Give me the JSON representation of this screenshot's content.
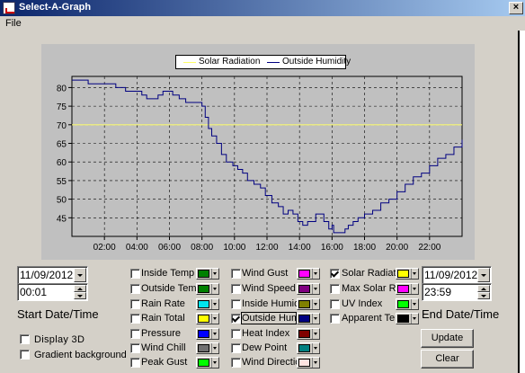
{
  "window": {
    "title": "Select-A-Graph",
    "close_label": "×"
  },
  "menu": {
    "file": "File"
  },
  "start": {
    "date": "11/09/2012",
    "time": "00:01",
    "label": "Start Date/Time"
  },
  "end": {
    "date": "11/09/2012",
    "time": "23:59",
    "label": "End Date/Time"
  },
  "display_options": [
    {
      "label": "Display 3D",
      "checked": false
    },
    {
      "label": "Gradient background",
      "checked": false
    }
  ],
  "series_options": [
    [
      {
        "label": "Inside Temp",
        "checked": false,
        "color": "#008000"
      },
      {
        "label": "Outside Temp",
        "checked": false,
        "color": "#008000"
      },
      {
        "label": "Rain Rate",
        "checked": false,
        "color": "#00e5ee"
      },
      {
        "label": "Rain Total",
        "checked": false,
        "color": "#ffff00"
      },
      {
        "label": "Pressure",
        "checked": false,
        "color": "#0000ff"
      },
      {
        "label": "Wind Chill",
        "checked": false,
        "color": "#707070"
      },
      {
        "label": "Peak Gust",
        "checked": false,
        "color": "#00ff00"
      }
    ],
    [
      {
        "label": "Wind Gust",
        "checked": false,
        "color": "#ff00ff"
      },
      {
        "label": "Wind Speed",
        "checked": false,
        "color": "#800080"
      },
      {
        "label": "Inside Humidity",
        "checked": false,
        "color": "#808000"
      },
      {
        "label": "Outside Humidit",
        "checked": true,
        "color": "#000080"
      },
      {
        "label": "Heat Index",
        "checked": false,
        "color": "#800000"
      },
      {
        "label": "Dew Point",
        "checked": false,
        "color": "#008080"
      },
      {
        "label": "Wind Direction",
        "checked": false,
        "color": "#ffe4e1"
      }
    ],
    [
      {
        "label": "Solar Radiation",
        "checked": true,
        "color": "#ffff00"
      },
      {
        "label": "Max Solar Rad",
        "checked": false,
        "color": "#ff00ff"
      },
      {
        "label": "UV Index",
        "checked": false,
        "color": "#00ff00"
      },
      {
        "label": "Apparent Temp",
        "checked": false,
        "color": "#000000"
      }
    ]
  ],
  "buttons": {
    "update": "Update",
    "clear": "Clear"
  },
  "chart_data": {
    "type": "line",
    "title": "",
    "xlabel": "",
    "ylabel": "",
    "xlim": [
      0,
      24
    ],
    "ylim": [
      40,
      83
    ],
    "x_ticks": [
      2,
      4,
      6,
      8,
      10,
      12,
      14,
      16,
      18,
      20,
      22
    ],
    "x_tick_labels": [
      "02:00",
      "04:00",
      "06:00",
      "08:00",
      "10:00",
      "12:00",
      "14:00",
      "16:00",
      "18:00",
      "20:00",
      "22:00"
    ],
    "y_ticks": [
      45,
      50,
      55,
      60,
      65,
      70,
      75,
      80
    ],
    "grid": true,
    "legend": "top-center",
    "series": [
      {
        "name": "Solar Radiation",
        "color": "#ffff66",
        "x": [
          0,
          24
        ],
        "y": [
          70,
          70
        ]
      },
      {
        "name": "Outside Humidity",
        "color": "#000080",
        "x": [
          0,
          0.8,
          1.0,
          1.5,
          2.4,
          2.7,
          3.0,
          3.3,
          3.7,
          4.3,
          4.6,
          5.0,
          5.3,
          5.6,
          6.0,
          6.2,
          6.6,
          7.0,
          7.4,
          7.8,
          8.0,
          8.2,
          8.4,
          8.6,
          8.9,
          9.2,
          9.5,
          9.9,
          10.2,
          10.5,
          10.8,
          11.2,
          11.6,
          11.9,
          12.3,
          12.7,
          13.0,
          13.3,
          13.6,
          13.9,
          14.2,
          14.5,
          14.8,
          15.0,
          15.3,
          15.5,
          15.8,
          16.0,
          16.1,
          16.3,
          16.5,
          16.8,
          17.0,
          17.3,
          17.6,
          18.0,
          18.5,
          19.0,
          19.5,
          20.0,
          20.5,
          21.0,
          21.5,
          22.0,
          22.5,
          23.0,
          23.5,
          24.0
        ],
        "y": [
          82,
          82,
          81,
          81,
          81,
          80,
          80,
          79,
          79,
          78,
          77,
          77,
          78,
          79,
          79,
          78,
          77,
          76,
          76,
          76,
          75,
          72,
          69,
          67,
          65,
          62,
          60,
          59,
          58,
          57,
          55,
          54,
          53,
          51,
          49,
          48,
          46,
          47,
          46,
          44,
          43,
          44,
          44,
          46,
          46,
          44,
          42,
          43,
          41,
          41,
          41,
          42,
          43,
          44,
          45,
          46,
          47,
          49,
          50,
          52,
          54,
          56,
          57,
          59,
          61,
          62,
          64,
          66
        ]
      }
    ]
  }
}
